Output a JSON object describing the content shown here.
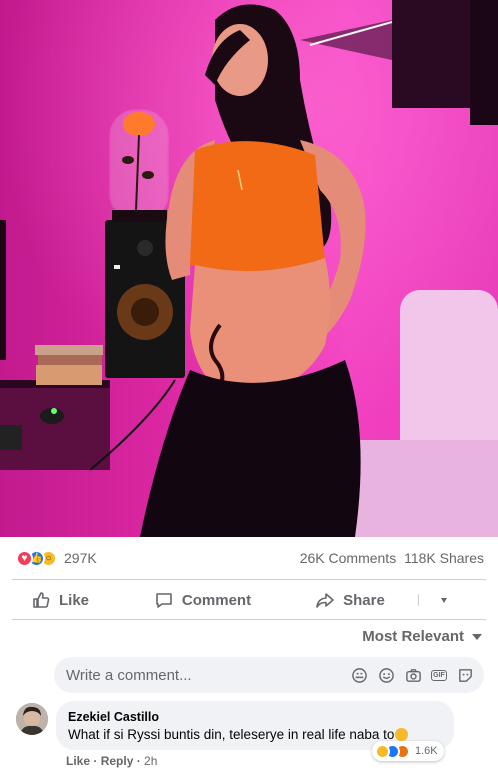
{
  "post": {
    "reaction_count": "297K",
    "comments_count": "26K Comments",
    "shares_count": "118K Shares"
  },
  "actions": {
    "like": "Like",
    "comment": "Comment",
    "share": "Share"
  },
  "sort_label": "Most Relevant",
  "comment_input": {
    "placeholder": "Write a comment..."
  },
  "comment": {
    "author": "Ezekiel Castillo",
    "text": "What if si Ryssi buntis din, teleserye in real life naba to",
    "reaction_count": "1.6K",
    "like_label": "Like",
    "reply_label": "Reply",
    "time": "2h"
  },
  "icons": {
    "love": "heart-icon",
    "like": "thumbs-up-icon",
    "wow": "wow-icon",
    "haha": "haha-icon",
    "angry": "angry-icon",
    "comment": "speech-bubble-icon",
    "share": "share-arrow-icon",
    "sticker": "sticker-icon",
    "emoji": "smiley-icon",
    "camera": "camera-icon",
    "gif": "gif-icon",
    "avatar_sticker": "avatar-sticker-icon"
  },
  "colors": {
    "accent": "#1877f2",
    "love": "#f33e58",
    "wow": "#f7b928",
    "text_muted": "#65676b",
    "bubble_bg": "#f0f2f5"
  }
}
